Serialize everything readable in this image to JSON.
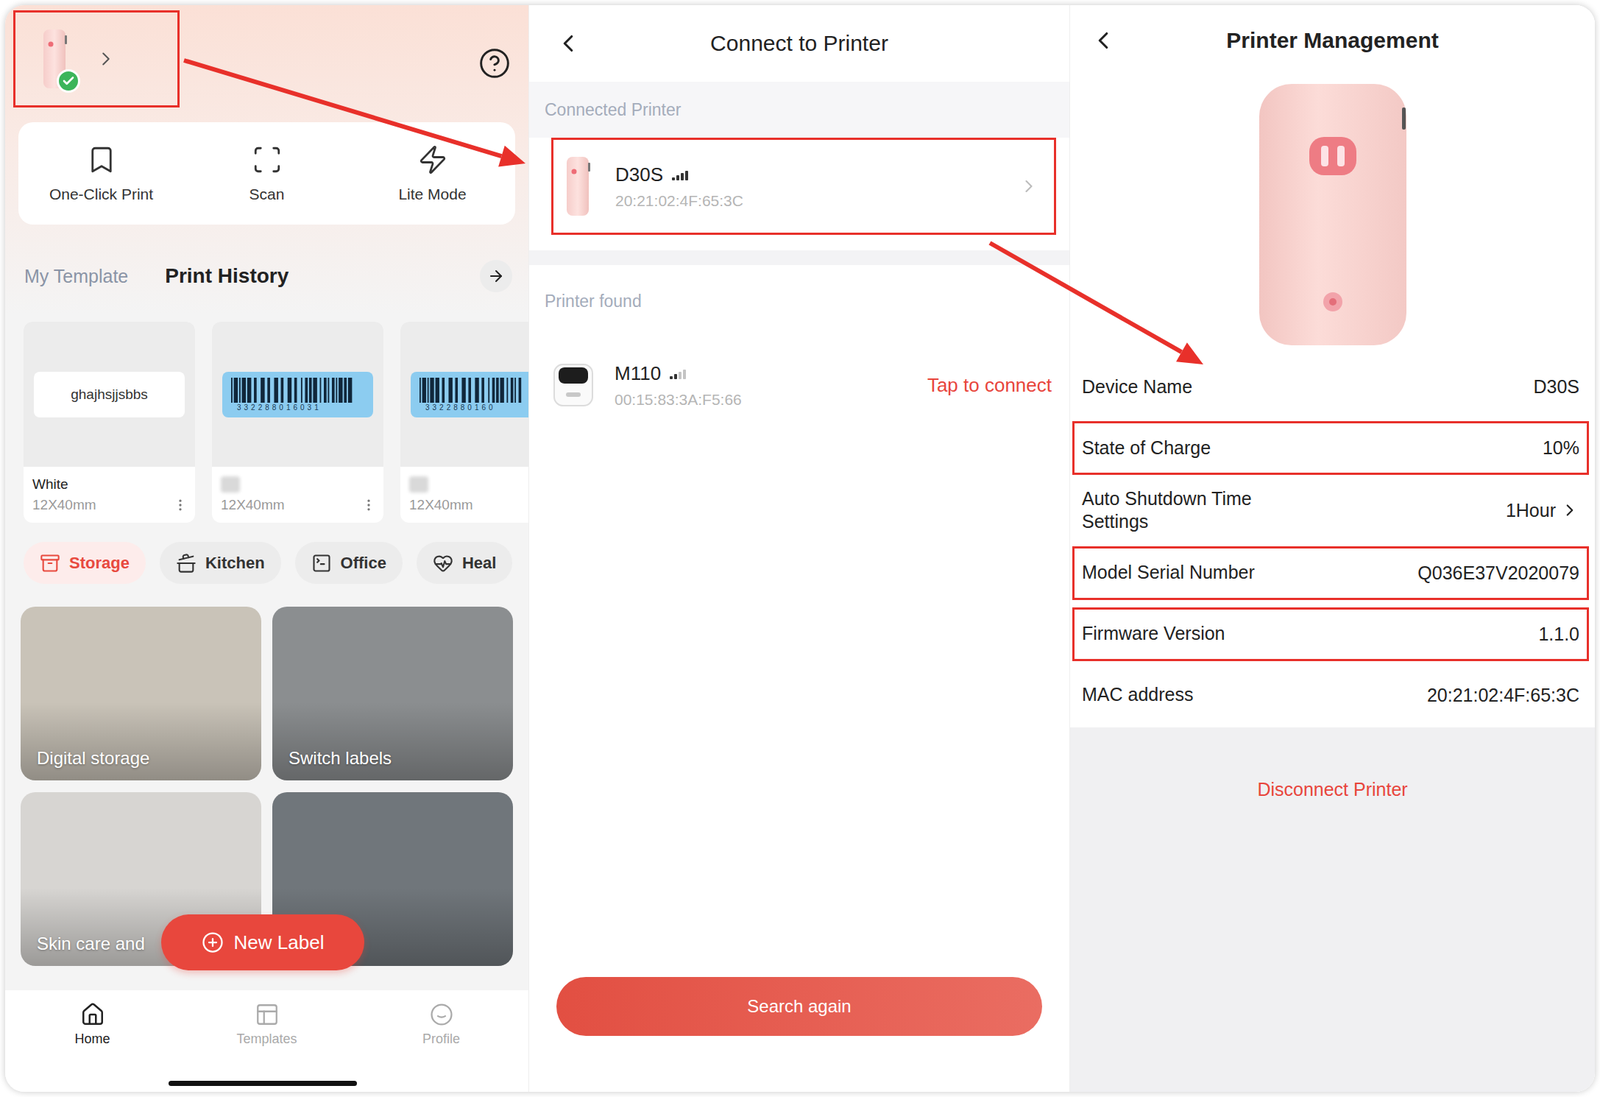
{
  "home": {
    "printer": {
      "connected": true,
      "highlighted": true
    },
    "actions": [
      {
        "label": "One-Click Print"
      },
      {
        "label": "Scan"
      },
      {
        "label": "Lite Mode"
      }
    ],
    "tabs": [
      {
        "label": "My Template",
        "selected": false
      },
      {
        "label": "Print History",
        "selected": true
      }
    ],
    "history": [
      {
        "kind": "text",
        "preview": "ghajhsjjsbbs",
        "name": "White",
        "blurred": false,
        "size": "12X40mm"
      },
      {
        "kind": "barcode",
        "preview": "332288016031",
        "blurred": true,
        "size": "12X40mm"
      },
      {
        "kind": "barcode",
        "preview": "3322880160",
        "blurred": true,
        "size": "12X40mm"
      }
    ],
    "categories": [
      {
        "label": "Storage",
        "selected": true
      },
      {
        "label": "Kitchen",
        "selected": false
      },
      {
        "label": "Office",
        "selected": false
      },
      {
        "label": "Heal",
        "selected": false
      }
    ],
    "scenes": [
      {
        "caption": "Digital storage"
      },
      {
        "caption": "Switch labels"
      },
      {
        "caption": "Skin care and"
      },
      {}
    ],
    "new_label": "New Label",
    "nav": [
      {
        "label": "Home",
        "selected": true
      },
      {
        "label": "Templates",
        "selected": false
      },
      {
        "label": "Profile",
        "selected": false
      }
    ]
  },
  "connect": {
    "title": "Connect to Printer",
    "connected_label": "Connected Printer",
    "connected": [
      {
        "name": "D30S",
        "mac": "20:21:02:4F:65:3C",
        "signal": 1,
        "highlighted": true
      }
    ],
    "found_label": "Printer found",
    "found": [
      {
        "name": "M110",
        "mac": "00:15:83:3A:F5:66",
        "signal": 0.5,
        "action": "Tap to connect"
      }
    ],
    "search": "Search again"
  },
  "management": {
    "title": "Printer Management",
    "rows": [
      {
        "label": "Device Name",
        "value": "D30S",
        "kind": "info",
        "highlighted": false
      },
      {
        "label": "State of Charge",
        "value": "10%",
        "kind": "info",
        "highlighted": true
      },
      {
        "label": "Auto Shutdown Time Settings",
        "value": "1Hour",
        "kind": "link",
        "highlighted": false
      },
      {
        "label": "Model Serial Number",
        "value": "Q036E37V2020079",
        "kind": "info",
        "highlighted": true
      },
      {
        "label": "Firmware Version",
        "value": "1.1.0",
        "kind": "info",
        "highlighted": true
      },
      {
        "label": "MAC address",
        "value": "20:21:02:4F:65:3C",
        "kind": "info",
        "highlighted": false
      }
    ],
    "disconnect": "Disconnect Printer"
  }
}
